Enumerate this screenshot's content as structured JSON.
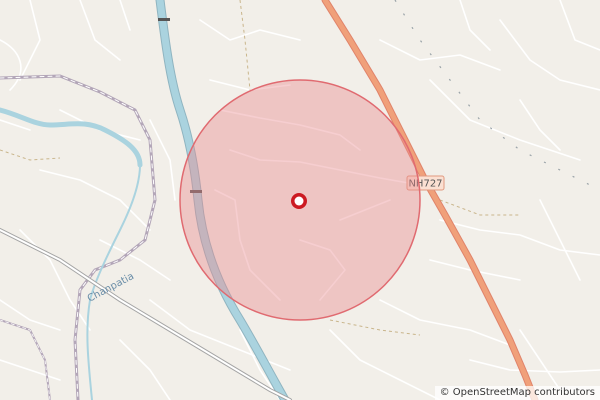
{
  "map": {
    "road_shield": "NH727",
    "place_label": "Chanpatia",
    "attribution": "© OpenStreetMap contributors",
    "colors": {
      "land": "#f2efe9",
      "highway": "#f0a07a",
      "highway_casing": "#e0836a",
      "river": "#aad3df",
      "canal_casing": "#8fb4c0",
      "minor_road": "#ffffff",
      "railway": "#b3a6b8",
      "circle_fill": "#e98a8f",
      "circle_stroke": "#e06a70",
      "marker": "#cc1a22"
    },
    "icons": {
      "marker": "location-ring-icon"
    }
  }
}
